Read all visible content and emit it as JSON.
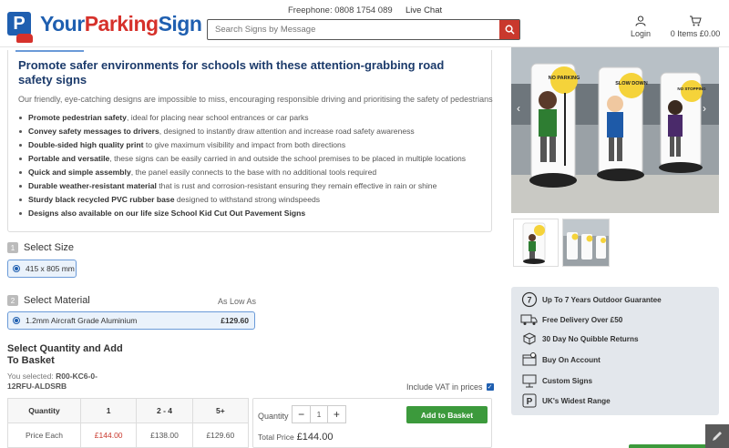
{
  "header": {
    "logo": {
      "part1": "Your",
      "part2": "Parking",
      "part3": "Sign"
    },
    "freephone_label": "Freephone:",
    "freephone_number": "0808 1754 089",
    "livechat": "Live Chat",
    "search_placeholder": "Search Signs by Message",
    "login": "Login",
    "basket": "0 Items £0.00"
  },
  "description": {
    "title": "Promote safer environments for schools with these attention-grabbing road safety signs",
    "intro": "Our friendly, eye-catching designs are impossible to miss, encouraging responsible driving and prioritising the safety of pedestrians",
    "bullets": [
      {
        "bold": "Promote pedestrian safety",
        "rest": ", ideal for placing near school entrances or car parks"
      },
      {
        "bold": "Convey safety messages to drivers",
        "rest": ", designed to instantly draw attention and increase road safety awareness"
      },
      {
        "bold": "Double-sided high quality print",
        "rest": " to give maximum visibility and impact from both directions"
      },
      {
        "bold": "Portable and versatile",
        "rest": ", these signs can be easily carried in and outside the school premises to be placed in multiple locations"
      },
      {
        "bold": "Quick and simple assembly",
        "rest": ", the panel easily connects to the base with no additional tools required"
      },
      {
        "bold": "Durable weather-resistant material",
        "rest": " that is rust and corrosion-resistant ensuring they remain effective in rain or shine"
      },
      {
        "bold": "Sturdy black recycled PVC rubber base",
        "rest": " designed to withstand strong windspeeds"
      },
      {
        "bold": "Designs also available on our life size School Kid Cut Out Pavement Signs",
        "rest": ""
      }
    ]
  },
  "size": {
    "num": "1",
    "label": "Select Size",
    "option": "415 x 805 mm"
  },
  "material": {
    "num": "2",
    "label": "Select Material",
    "as_low_as": "As Low As",
    "option": "1.2mm Aircraft Grade Aluminium",
    "price": "£129.60"
  },
  "quantity": {
    "title": "Select Quantity and Add To Basket",
    "selected_label": "You selected:",
    "selected_code": "R00-KC6-0-12RFU-ALDSRB",
    "vat_label": "Include VAT in prices",
    "table_headers": [
      "Quantity",
      "1",
      "2 - 4",
      "5+"
    ],
    "table_row": [
      "Price Each",
      "£144.00",
      "£138.00",
      "£129.60"
    ],
    "qty_label": "Quantity",
    "qty_value": "1",
    "minus": "−",
    "plus": "+",
    "add_button": "Add to Basket",
    "total_label": "Total Price",
    "total_value": "£144.00"
  },
  "gallery": {
    "signs": [
      "NO PARKING",
      "SLOW DOWN",
      "NO STOPPING"
    ]
  },
  "features": [
    {
      "icon": "badge-7-icon",
      "text": "Up To 7 Years Outdoor Guarantee"
    },
    {
      "icon": "truck-icon",
      "text": "Free Delivery Over £50"
    },
    {
      "icon": "return-box-icon",
      "text": "30 Day No Quibble Returns"
    },
    {
      "icon": "account-icon",
      "text": "Buy On Account"
    },
    {
      "icon": "custom-sign-icon",
      "text": "Custom Signs"
    },
    {
      "icon": "parking-range-icon",
      "text": "UK's Widest Range"
    }
  ],
  "colors": {
    "brand_blue": "#1f5fb0",
    "brand_red": "#d6312b",
    "button_green": "#3c9a3c"
  }
}
